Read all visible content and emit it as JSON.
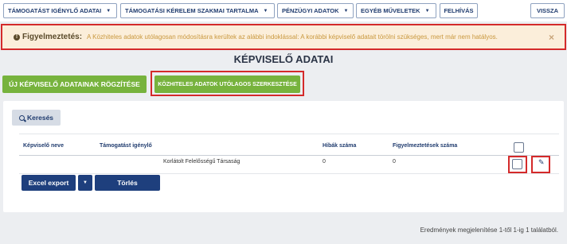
{
  "nav": {
    "items": [
      {
        "label": "TÁMOGATÁST IGÉNYLŐ ADATAI"
      },
      {
        "label": "TÁMOGATÁSI KÉRELEM SZAKMAI TARTALMA"
      },
      {
        "label": "PÉNZÜGYI ADATOK"
      },
      {
        "label": "EGYÉB MŰVELETEK"
      }
    ],
    "felhivas": "FELHÍVÁS",
    "vissza": "VISSZA"
  },
  "alert": {
    "title": "Figyelmeztetés:",
    "message": "A Közhiteles adatok utólagosan módosításra kerültek az alábbi indoklással: A korábbi képviselő adatait törölni szükséges, mert már nem hatályos.",
    "close": "×",
    "icon": "exclamation-circle-icon"
  },
  "page_title": "KÉPVISELŐ ADATAI",
  "actions": {
    "new_label": "ÚJ KÉPVISELŐ ADATAINAK RÖGZÍTÉSE",
    "edit_label": "KÖZHITELES ADATOK UTÓLAGOS SZERKESZTÉSE"
  },
  "search_label": "Keresés",
  "table": {
    "headers": [
      "Képviselő neve",
      "Támogatást igénylő",
      "Hibák száma",
      "Figyelmeztetések száma"
    ],
    "rows": [
      {
        "nev": "",
        "igenylo": "Korlátolt Felelősségű Társaság",
        "hibak": "0",
        "figyelmeztetesek": "0"
      }
    ]
  },
  "buttons": {
    "excel": "Excel export",
    "caret": "▼",
    "delete": "Törlés"
  },
  "footer": "Eredmények megjelenítése 1-től 1-ig 1 találatból.",
  "colors": {
    "accent_green": "#77b33d",
    "navy": "#1e3f7d",
    "highlight_red": "#d42a2a",
    "alert_bg": "#fbeeda"
  }
}
